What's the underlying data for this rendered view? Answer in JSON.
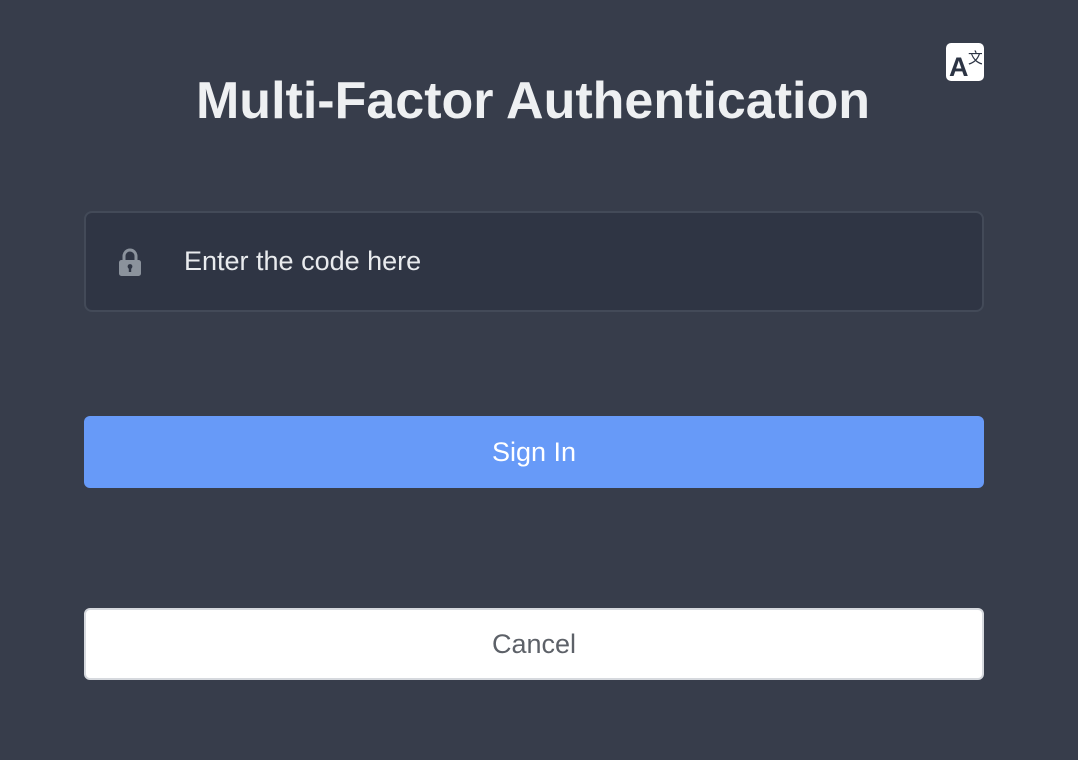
{
  "page": {
    "title": "Multi-Factor Authentication"
  },
  "language_button": {
    "icon": "translate-icon",
    "glyph_latin": "A",
    "glyph_cjk": "文"
  },
  "code_field": {
    "icon": "lock-icon",
    "value": "",
    "placeholder": "Enter the code here"
  },
  "actions": {
    "sign_in_label": "Sign In",
    "cancel_label": "Cancel"
  },
  "colors": {
    "background": "#373d4b",
    "input_background": "#2f3544",
    "primary": "#679af8",
    "cancel_background": "#ffffff",
    "cancel_text": "#5d6168"
  }
}
